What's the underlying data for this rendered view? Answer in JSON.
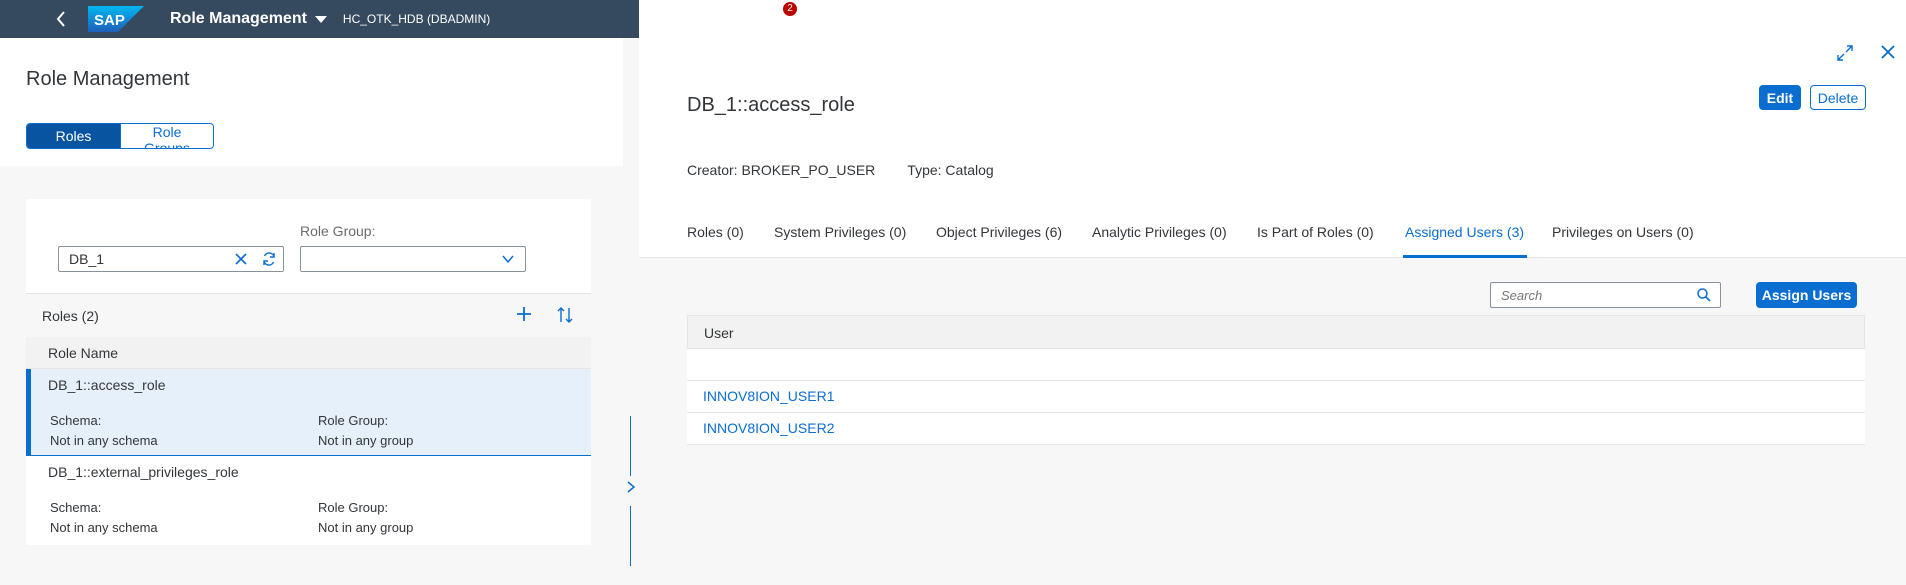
{
  "shell": {
    "logo": "SAP",
    "app_title": "Role Management",
    "system": "HC_OTK_HDB (DBADMIN)",
    "notification_count": "2"
  },
  "left": {
    "title": "Role Management",
    "segments": [
      "Roles",
      "Role Groups"
    ],
    "filter": {
      "search_value": "DB_1",
      "role_group_label": "Role Group:",
      "role_group_value": ""
    },
    "list_count": "Roles (2)",
    "column_header": "Role Name",
    "roles": [
      {
        "name": "DB_1::access_role",
        "schema_label": "Schema:",
        "schema_value": "Not in any schema",
        "group_label": "Role Group:",
        "group_value": "Not in any group"
      },
      {
        "name": "DB_1::external_privileges_role",
        "schema_label": "Schema:",
        "schema_value": "Not in any schema",
        "group_label": "Role Group:",
        "group_value": "Not in any group"
      }
    ]
  },
  "detail": {
    "title": "DB_1::access_role",
    "edit_label": "Edit",
    "delete_label": "Delete",
    "creator": "Creator: BROKER_PO_USER",
    "type": "Type: Catalog",
    "tabs": [
      "Roles (0)",
      "System Privileges (0)",
      "Object Privileges (6)",
      "Analytic Privileges (0)",
      "Is Part of Roles (0)",
      "Assigned Users (3)",
      "Privileges on Users (0)"
    ],
    "search_placeholder": "Search",
    "assign_label": "Assign Users",
    "users_header": "User",
    "users": [
      "",
      "INNOV8ION_USER1",
      "INNOV8ION_USER2"
    ]
  },
  "colors": {
    "shell": "#354a5f",
    "accent": "#0a6ed1",
    "selected_row": "#e5f0fa"
  }
}
